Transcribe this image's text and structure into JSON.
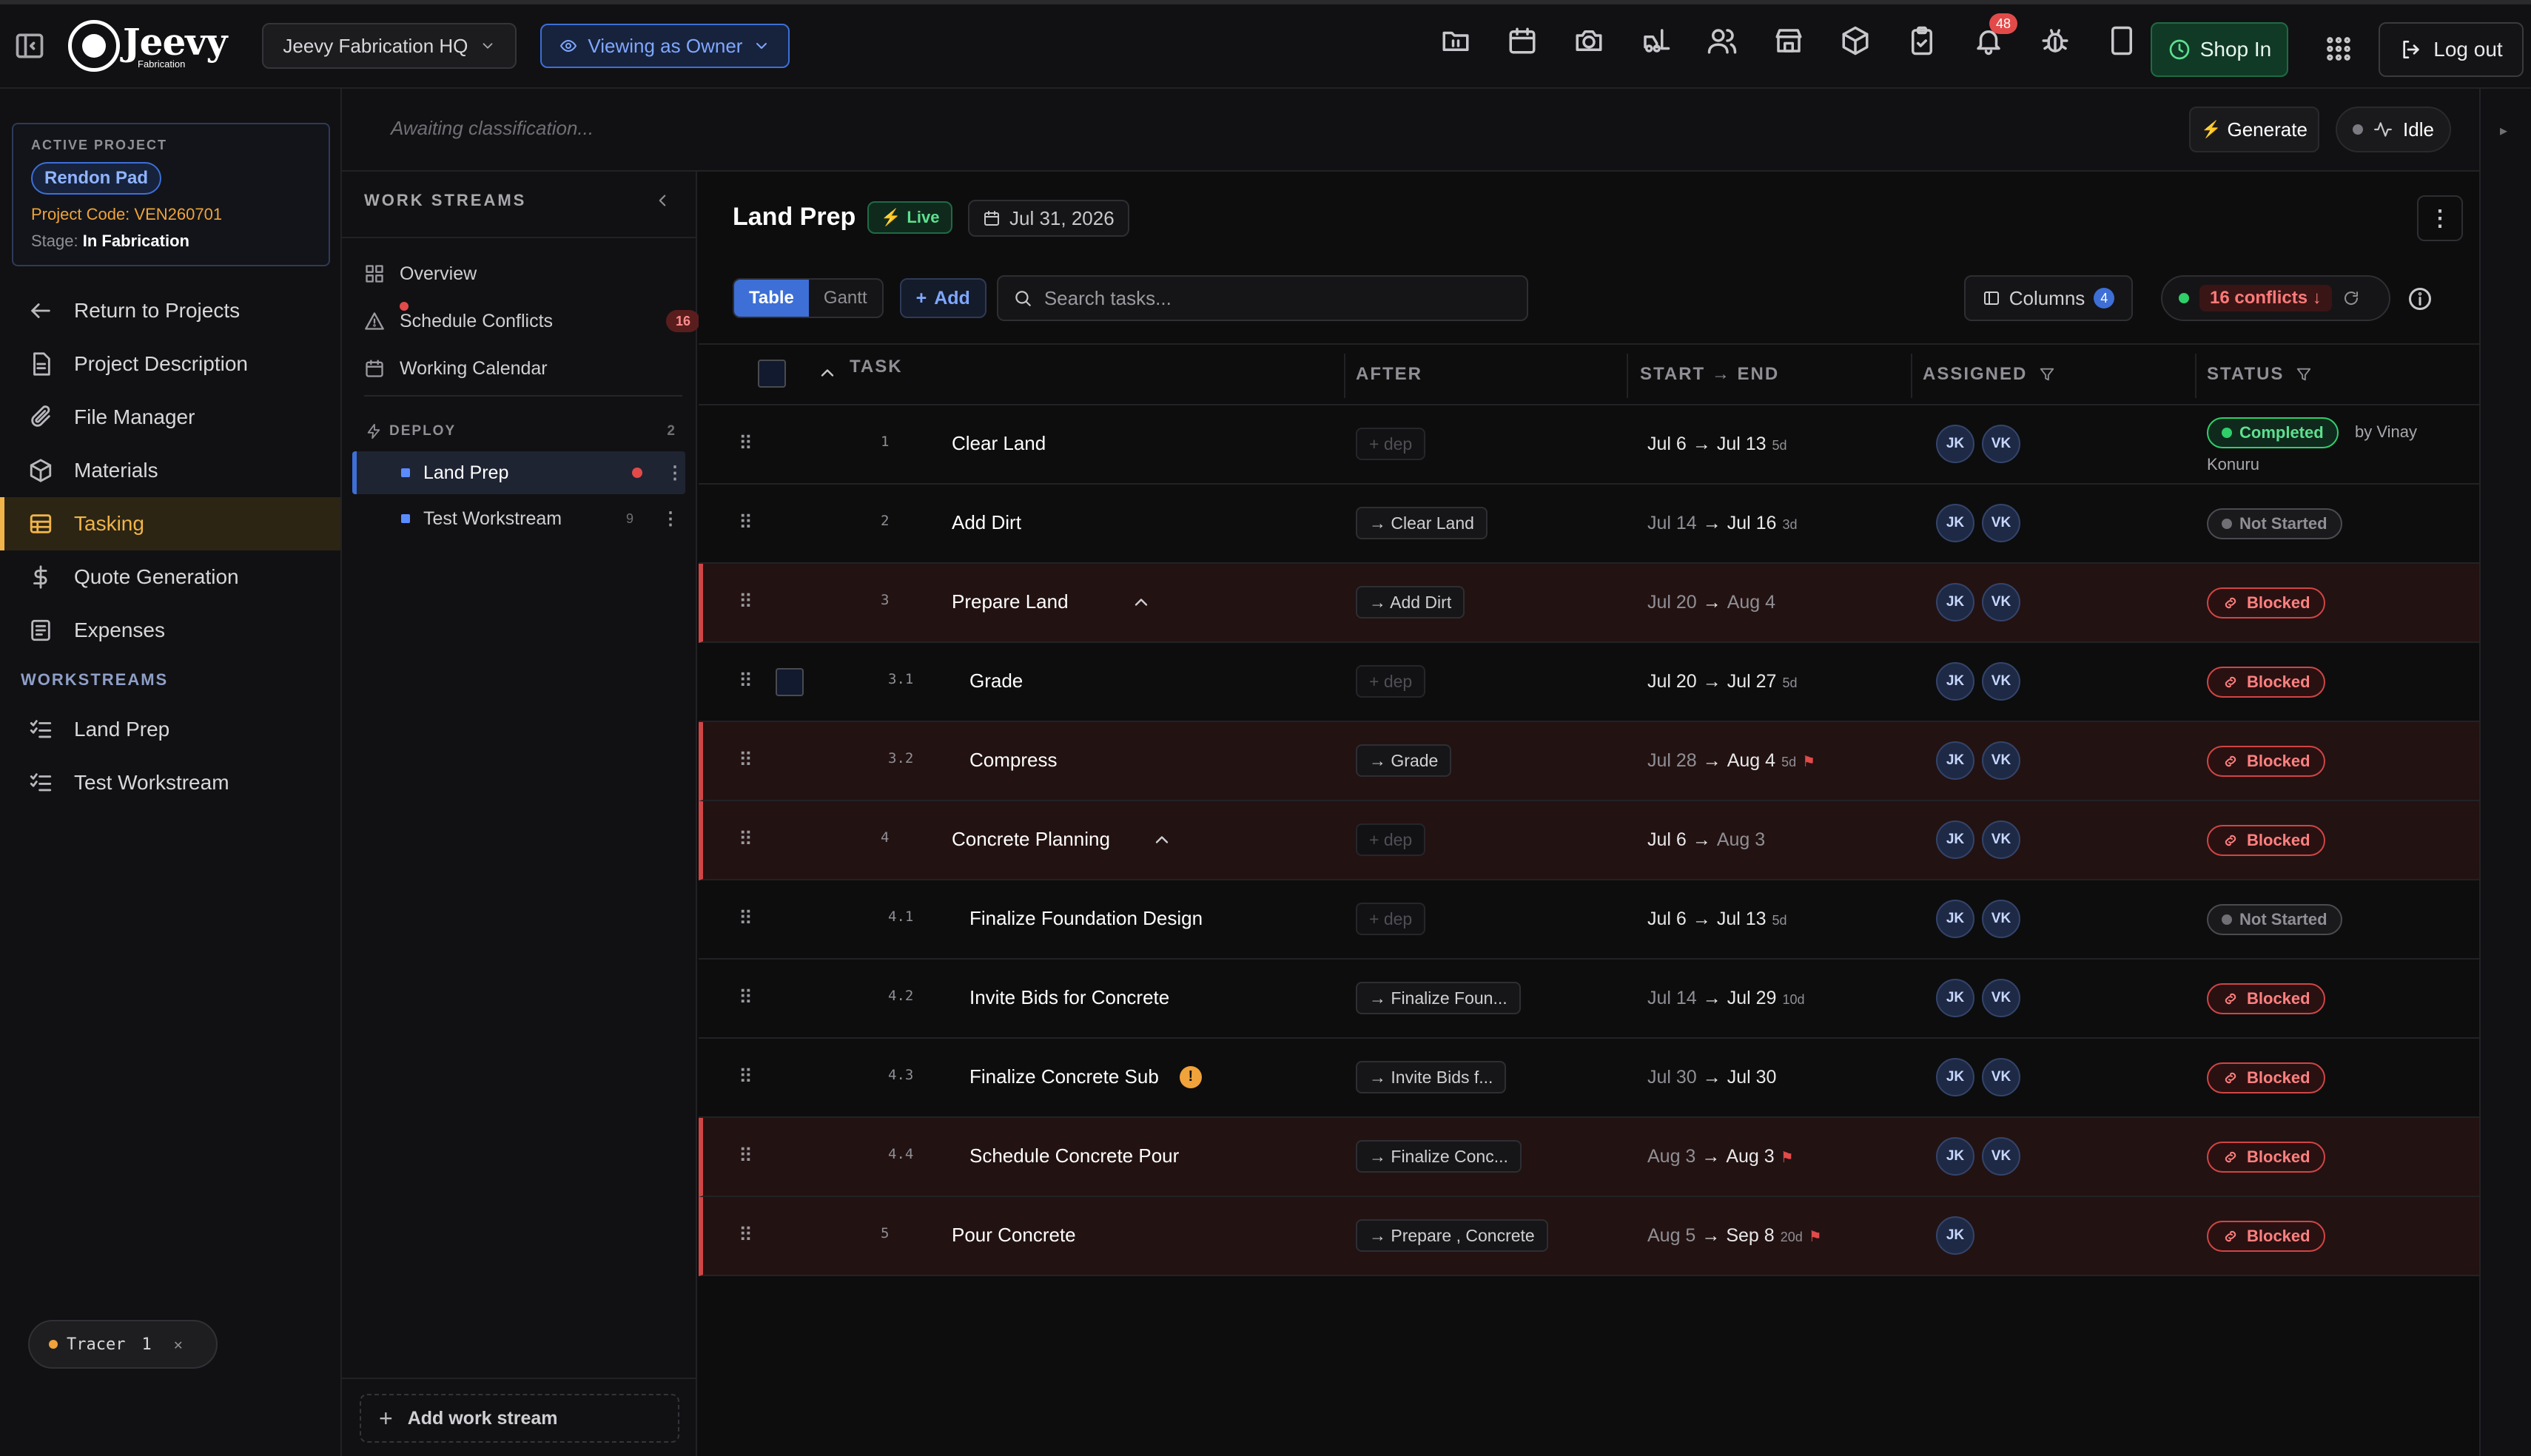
{
  "topbar": {
    "logo_word": "Jeevy",
    "logo_sub": "Fabrication",
    "org": "Jeevy Fabrication HQ",
    "view_mode": "Viewing as Owner",
    "notifications_count": "48",
    "shop_in": "Shop In",
    "logout": "Log out",
    "icons": [
      "folder-icon",
      "calendar-icon",
      "camera-icon",
      "forklift-icon",
      "users-icon",
      "store-icon",
      "package-icon",
      "clipboard-check-icon",
      "bell-icon",
      "bug-icon",
      "tablet-icon"
    ]
  },
  "project": {
    "label": "ACTIVE PROJECT",
    "name": "Rendon Pad",
    "code": "Project Code: VEN260701",
    "stage_label": "Stage:",
    "stage_value": "In Fabrication"
  },
  "nav": {
    "items": [
      {
        "label": "Return to Projects",
        "icon": "arrow-left-icon"
      },
      {
        "label": "Project Description",
        "icon": "document-icon"
      },
      {
        "label": "File Manager",
        "icon": "paperclip-icon"
      },
      {
        "label": "Materials",
        "icon": "cube-icon"
      },
      {
        "label": "Tasking",
        "icon": "table-icon"
      },
      {
        "label": "Quote Generation",
        "icon": "dollar-icon"
      },
      {
        "label": "Expenses",
        "icon": "receipt-icon"
      }
    ],
    "workstreams_label": "WORKSTREAMS",
    "workstreams": [
      {
        "label": "Land Prep"
      },
      {
        "label": "Test Workstream"
      }
    ],
    "tracer_label": "Tracer",
    "tracer_count": "1"
  },
  "classification": {
    "text": "Awaiting classification...",
    "generate": "Generate",
    "idle": "Idle"
  },
  "workstreams_panel": {
    "title": "WORK STREAMS",
    "items": [
      {
        "label": "Overview"
      },
      {
        "label": "Schedule Conflicts",
        "badge": "16"
      },
      {
        "label": "Working Calendar"
      }
    ],
    "group_label": "DEPLOY",
    "group_count": "2",
    "streams": [
      {
        "label": "Land Prep"
      },
      {
        "label": "Test Workstream",
        "count": "9"
      }
    ],
    "add_label": "Add work stream"
  },
  "main": {
    "title": "Land Prep",
    "live": "Live",
    "date": "Jul 31, 2026",
    "view_table": "Table",
    "view_gantt": "Gantt",
    "add": "Add",
    "search_placeholder": "Search tasks...",
    "columns_label": "Columns",
    "columns_count": "4",
    "conflicts_label": "16 conflicts",
    "headers": {
      "task": "TASK",
      "after": "AFTER",
      "start_end": "START → END",
      "assigned": "ASSIGNED",
      "status": "STATUS"
    }
  },
  "tasks": [
    {
      "num": "1",
      "name": "Clear Land",
      "dep": "+ dep",
      "start": "Jul 6",
      "end": "Jul 13",
      "dur": "5d",
      "assignees": [
        "JK",
        "VK"
      ],
      "status": "Completed",
      "by": "by Vinay Konuru"
    },
    {
      "num": "2",
      "name": "Add Dirt",
      "dep": "→ Clear Land",
      "start": "Jul 14",
      "end": "Jul 16",
      "dur": "3d",
      "assignees": [
        "JK",
        "VK"
      ],
      "status": "Not Started"
    },
    {
      "num": "3",
      "name": "Prepare Land",
      "dep": "→ Add Dirt",
      "start": "Jul 20",
      "end": "Aug 4",
      "dur": "",
      "assignees": [
        "JK",
        "VK"
      ],
      "status": "Blocked"
    },
    {
      "num": "3.1",
      "name": "Grade",
      "dep": "+ dep",
      "start": "Jul 20",
      "end": "Jul 27",
      "dur": "5d",
      "assignees": [
        "JK",
        "VK"
      ],
      "status": "Blocked"
    },
    {
      "num": "3.2",
      "name": "Compress",
      "dep": "→ Grade",
      "start": "Jul 28",
      "end": "Aug 4",
      "dur": "5d",
      "assignees": [
        "JK",
        "VK"
      ],
      "status": "Blocked"
    },
    {
      "num": "4",
      "name": "Concrete Planning",
      "dep": "+ dep",
      "start": "Jul 6",
      "end": "Aug 3",
      "dur": "",
      "assignees": [
        "JK",
        "VK"
      ],
      "status": "Blocked"
    },
    {
      "num": "4.1",
      "name": "Finalize Foundation Design",
      "dep": "+ dep",
      "start": "Jul 6",
      "end": "Jul 13",
      "dur": "5d",
      "assignees": [
        "JK",
        "VK"
      ],
      "status": "Not Started"
    },
    {
      "num": "4.2",
      "name": "Invite Bids for Concrete",
      "dep": "→ Finalize Foun...",
      "start": "Jul 14",
      "end": "Jul 29",
      "dur": "10d",
      "assignees": [
        "JK",
        "VK"
      ],
      "status": "Blocked"
    },
    {
      "num": "4.3",
      "name": "Finalize Concrete Sub",
      "dep": "→ Invite Bids f...",
      "start": "Jul 30",
      "end": "Jul 30",
      "dur": "",
      "assignees": [
        "JK",
        "VK"
      ],
      "status": "Blocked"
    },
    {
      "num": "4.4",
      "name": "Schedule Concrete Pour",
      "dep": "→ Finalize Conc...",
      "start": "Aug 3",
      "end": "Aug 3",
      "dur": "",
      "assignees": [
        "JK",
        "VK"
      ],
      "status": "Blocked"
    },
    {
      "num": "5",
      "name": "Pour Concrete",
      "dep": "→ Prepare , Concrete",
      "start": "Aug 5",
      "end": "Sep 8",
      "dur": "20d",
      "assignees": [
        "JK"
      ],
      "status": "Blocked"
    }
  ]
}
